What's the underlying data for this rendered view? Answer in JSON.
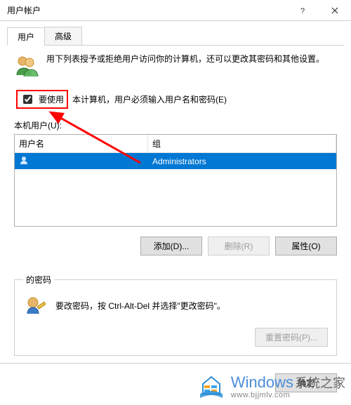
{
  "window": {
    "title": "用户帐户"
  },
  "tabs": [
    {
      "label": "用户",
      "active": true
    },
    {
      "label": "高级",
      "active": false
    }
  ],
  "intro_text": "用下列表授予或拒绝用户访问你的计算机，还可以更改其密码和其他设置。",
  "require_login": {
    "label": "要使用本计算机，用户必须输入用户名和密码(E)",
    "checked": true
  },
  "user_list_label": "本机用户(U):",
  "user_table": {
    "columns": {
      "username": "用户名",
      "group": "组"
    },
    "rows": [
      {
        "username": "",
        "group": "Administrators"
      }
    ]
  },
  "buttons": {
    "add": "添加(D)...",
    "remove": "删除(R)",
    "properties": "属性(O)",
    "ok": "确定",
    "reset_pw": "重置密码(P)..."
  },
  "password_box": {
    "legend": "的密码",
    "text": "要改密码，按 Ctrl-Alt-Del 并选择\"更改密码\"。"
  },
  "watermark": {
    "brand_en": "Windows",
    "brand_cn": "系统之家",
    "url": "www.bjjmlv.com"
  }
}
